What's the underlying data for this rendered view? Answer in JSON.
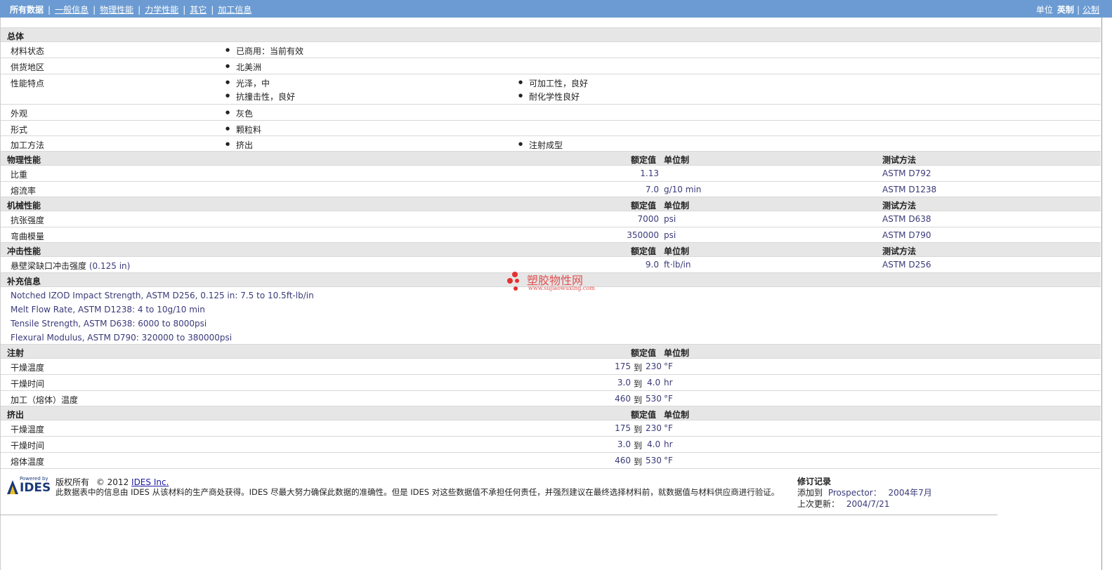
{
  "topbar": {
    "tabs": [
      "所有数据",
      "一般信息",
      "物理性能",
      "力学性能",
      "其它",
      "加工信息"
    ],
    "units_label": "单位",
    "unit_current": "英制",
    "unit_other": "公制",
    "sep": "|"
  },
  "general": {
    "title": "总体",
    "rows": [
      {
        "label": "材料状态",
        "items": [
          "已商用：当前有效"
        ]
      },
      {
        "label": "供货地区",
        "items": [
          "北美洲"
        ]
      },
      {
        "label": "性能特点",
        "items": [
          "光泽，中",
          "可加工性，良好",
          "抗撞击性，良好",
          "耐化学性良好"
        ]
      },
      {
        "label": "外观",
        "items": [
          "灰色"
        ]
      },
      {
        "label": "形式",
        "items": [
          "颗粒料"
        ]
      },
      {
        "label": "加工方法",
        "items": [
          "挤出",
          "注射成型"
        ]
      }
    ]
  },
  "col_headers": {
    "value": "额定值",
    "unit": "单位制",
    "method": "测试方法"
  },
  "physical": {
    "title": "物理性能",
    "rows": [
      {
        "label": "比重",
        "value": "1.13",
        "unit": "",
        "method": "ASTM D792"
      },
      {
        "label": "熔流率",
        "value": "7.0",
        "unit": "g/10 min",
        "method": "ASTM D1238"
      }
    ]
  },
  "mechanical": {
    "title": "机械性能",
    "rows": [
      {
        "label": "抗张强度",
        "value": "7000",
        "unit": "psi",
        "method": "ASTM D638"
      },
      {
        "label": "弯曲模量",
        "value": "350000",
        "unit": "psi",
        "method": "ASTM D790"
      }
    ]
  },
  "impact": {
    "title": "冲击性能",
    "rows": [
      {
        "label": "悬壁梁缺口冲击强度",
        "label_extra": "(0.125 in)",
        "value": "9.0",
        "unit": "ft·lb/in",
        "method": "ASTM D256"
      }
    ]
  },
  "supplement": {
    "title": "补充信息",
    "notes": [
      "Notched IZOD Impact Strength, ASTM D256, 0.125 in: 7.5 to 10.5ft-lb/in",
      "Melt Flow Rate, ASTM D1238: 4 to 10g/10 min",
      "Tensile Strength, ASTM D638: 6000 to 8000psi",
      "Flexural Modulus, ASTM D790: 320000 to 380000psi"
    ]
  },
  "injection": {
    "title": "注射",
    "rows": [
      {
        "label": "干燥温度",
        "from": "175",
        "to_word": "到",
        "to": "230",
        "unit": "°F"
      },
      {
        "label": "干燥时间",
        "from": "3.0",
        "to_word": "到",
        "to": "4.0",
        "unit": "hr"
      },
      {
        "label": "加工（熔体）温度",
        "from": "460",
        "to_word": "到",
        "to": "530",
        "unit": "°F"
      }
    ]
  },
  "extrusion": {
    "title": "挤出",
    "rows": [
      {
        "label": "干燥温度",
        "from": "175",
        "to_word": "到",
        "to": "230",
        "unit": "°F"
      },
      {
        "label": "干燥时间",
        "from": "3.0",
        "to_word": "到",
        "to": "4.0",
        "unit": "hr"
      },
      {
        "label": "熔体温度",
        "from": "460",
        "to_word": "到",
        "to": "530",
        "unit": "°F"
      }
    ]
  },
  "watermark": {
    "title": "塑胶物性网",
    "url": "www.sujiaowuxing.com"
  },
  "footer": {
    "logo_small": "Powered by",
    "logo_big": "IDES",
    "copyright_label": "版权所有",
    "copyright_year": "© 2012",
    "company_link": "IDES Inc.",
    "disclaimer": "此数据表中的信息由 IDES 从该材料的生产商处获得。IDES 尽最大努力确保此数据的准确性。但是 IDES 对这些数据值不承担任何责任，并强烈建议在最终选择材料前，就数据值与材料供应商进行验证。",
    "revision_title": "修订记录",
    "added_label": "添加到",
    "added_target": "Prospector：",
    "added_date": "2004年7月",
    "updated_label": "上次更新：",
    "updated_date": "2004/7/21"
  }
}
